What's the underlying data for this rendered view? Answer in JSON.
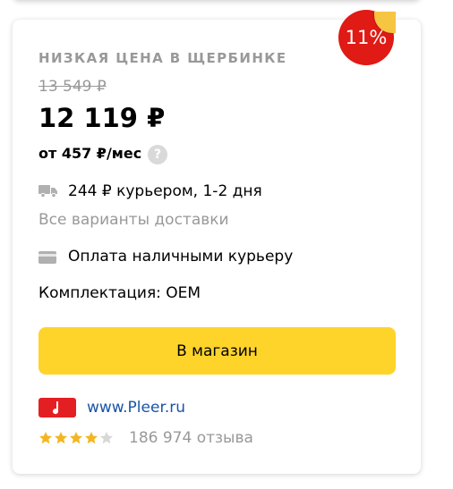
{
  "offer": {
    "discount_badge": "11%",
    "promo_label": "НИЗКАЯ ЦЕНА В ЩЕРБИНКЕ",
    "old_price": "13 549 ₽",
    "price": "12 119 ₽",
    "credit": "от 457 ₽/мес",
    "help_symbol": "?",
    "delivery_text": "244 ₽ курьером, 1-2 дня",
    "delivery_link": "Все варианты доставки",
    "payment_text": "Оплата наличными курьеру",
    "kit_text": "Комплектация:  OEM",
    "shop_button": "В магазин",
    "shop_name": "www.Pleer.ru",
    "rating": 4,
    "rating_max": 5,
    "reviews_text": "186 974 отзыва"
  },
  "colors": {
    "badge": "#e01a14",
    "button": "#fed42b",
    "link": "#1a54a8",
    "star": "#f3b623",
    "star_empty": "#d8d8d8"
  },
  "icons": [
    "truck-icon",
    "credit-card-icon",
    "question-icon",
    "shop-logo-icon",
    "star-icon"
  ]
}
